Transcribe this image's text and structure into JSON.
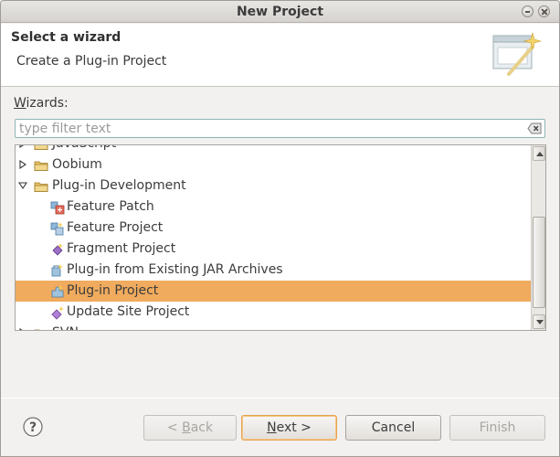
{
  "window": {
    "title": "New Project"
  },
  "banner": {
    "title": "Select a wizard",
    "description": "Create a Plug-in Project"
  },
  "wizards_label": {
    "mnemonic": "W",
    "rest": "izards:"
  },
  "filter": {
    "placeholder": "type filter text",
    "value": ""
  },
  "tree": {
    "items": [
      {
        "label": "JavaScript",
        "level": 0,
        "kind": "folder",
        "expanded": false,
        "selected": false
      },
      {
        "label": "Oobium",
        "level": 0,
        "kind": "folder",
        "expanded": false,
        "selected": false
      },
      {
        "label": "Plug-in Development",
        "level": 0,
        "kind": "folder",
        "expanded": true,
        "selected": false
      },
      {
        "label": "Feature Patch",
        "level": 1,
        "kind": "feature-patch",
        "selected": false
      },
      {
        "label": "Feature Project",
        "level": 1,
        "kind": "feature-project",
        "selected": false
      },
      {
        "label": "Fragment Project",
        "level": 1,
        "kind": "fragment-project",
        "selected": false
      },
      {
        "label": "Plug-in from Existing JAR Archives",
        "level": 1,
        "kind": "plugin-jar",
        "selected": false
      },
      {
        "label": "Plug-in Project",
        "level": 1,
        "kind": "plugin-project",
        "selected": true
      },
      {
        "label": "Update Site Project",
        "level": 1,
        "kind": "update-site",
        "selected": false
      },
      {
        "label": "SVN",
        "level": 0,
        "kind": "folder",
        "expanded": false,
        "selected": false
      }
    ],
    "selection_color": "#f0ab5e"
  },
  "buttons": {
    "back": {
      "mnemonic": "B",
      "label": "< Back",
      "enabled": false
    },
    "next": {
      "mnemonic": "N",
      "label": "Next >",
      "enabled": true,
      "default": true
    },
    "cancel": {
      "label": "Cancel",
      "enabled": true
    },
    "finish": {
      "label": "Finish",
      "enabled": false
    }
  }
}
